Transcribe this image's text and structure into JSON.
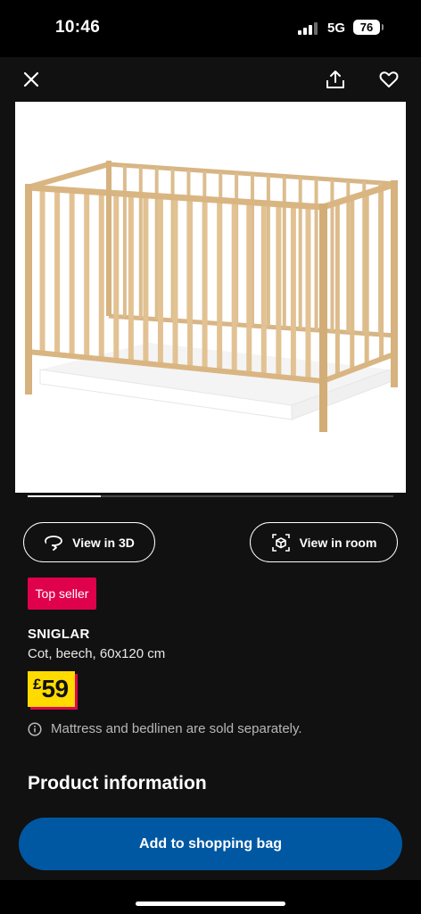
{
  "status_bar": {
    "time": "10:46",
    "network": "5G",
    "battery": "76"
  },
  "nav": {
    "close_icon": "close-icon",
    "share_icon": "share-icon",
    "favourite_icon": "heart-icon"
  },
  "product": {
    "image_alt": "SNIGLAR cot",
    "image_progress": 0.2,
    "badge": "Top seller",
    "name": "SNIGLAR",
    "description": "Cot, beech, 60x120 cm",
    "price_currency": "£",
    "price_value": "59",
    "note": "Mattress and bedlinen are sold separately."
  },
  "actions": {
    "view_3d": "View in 3D",
    "view_room": "View in room"
  },
  "section": {
    "product_information": "Product information"
  },
  "cta": {
    "add_to_bag": "Add to shopping bag"
  },
  "colors": {
    "background": "#111111",
    "badge": "#e0014d",
    "price_bg": "#ffdb00",
    "price_shadow": "#e00751",
    "primary_button": "#0058a3"
  }
}
